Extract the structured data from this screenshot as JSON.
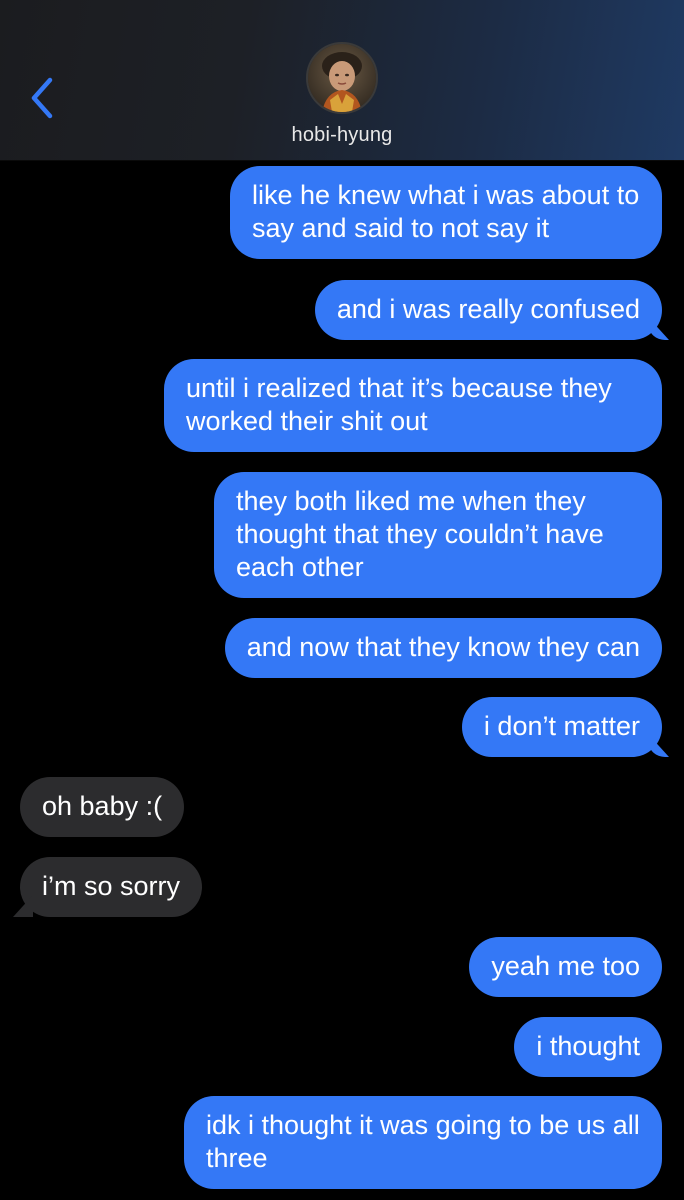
{
  "header": {
    "contact_name": "hobi-hyung",
    "back_icon": "chevron-left-icon",
    "accent_color": "#3478f6"
  },
  "messages": [
    {
      "from": "me",
      "text": "like he knew what i was about to say and said to not say it"
    },
    {
      "from": "me",
      "text": "and i was really confused"
    },
    {
      "from": "me",
      "text": "until i realized that it’s because they worked their shit out"
    },
    {
      "from": "me",
      "text": "they both liked me when they thought that they couldn’t have each other"
    },
    {
      "from": "me",
      "text": "and now that they know they can"
    },
    {
      "from": "me",
      "text": "i don’t matter"
    },
    {
      "from": "them",
      "text": "oh baby :("
    },
    {
      "from": "them",
      "text": "i’m so sorry"
    },
    {
      "from": "me",
      "text": "yeah me too"
    },
    {
      "from": "me",
      "text": "i thought"
    },
    {
      "from": "me",
      "text": "idk i thought it was going to be us all three"
    }
  ],
  "colors": {
    "sent_bubble": "#3478f6",
    "received_bubble": "#2c2c2e",
    "background": "#000000"
  }
}
